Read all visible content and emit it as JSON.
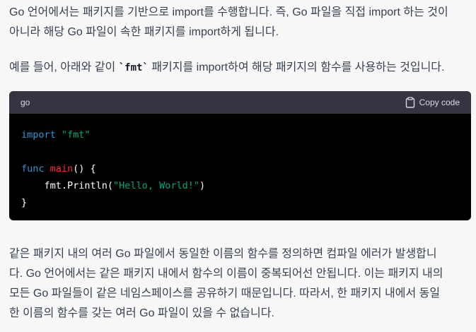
{
  "paragraph1": {
    "line1": "Go 언어에서는 패키지를 기반으로 import를 수행합니다. 즉, Go 파일을 직접 import 하는 것이",
    "line2": "아니라 해당 Go 파일이 속한 패키지를 import하게 됩니다."
  },
  "paragraph2": {
    "before": "예를 들어, 아래와 같이 ",
    "code": "`fmt`",
    "after": " 패키지를 import하여 해당 패키지의 함수를 사용하는 것입니다."
  },
  "code_block": {
    "language": "go",
    "copy_label": "Copy code",
    "copy_icon": "clipboard-icon",
    "lines": {
      "l1_keyword": "import",
      "l1_string": "\"fmt\"",
      "l3_keyword": "func",
      "l3_name": "main",
      "l3_rest": "() {",
      "l4_prefix": "    fmt.Println(",
      "l4_string": "\"Hello, World!\"",
      "l4_suffix": ")",
      "l5": "}"
    }
  },
  "paragraph3": {
    "line1": "같은 패키지 내의 여러 Go 파일에서 동일한 이름의 함수를 정의하면 컴파일 에러가 발생합니",
    "line2": "다. Go 언어에서는 같은 패키지 내에서 함수의 이름이 중복되어선 안됩니다. 이는 패키지 내의",
    "line3": "모든 Go 파일들이 같은 네임스페이스를 공유하기 때문입니다. 따라서, 한 패키지 내에서 동일",
    "line4": "한 이름의 함수를 갖는 여러 Go 파일이 있을 수 없습니다."
  }
}
